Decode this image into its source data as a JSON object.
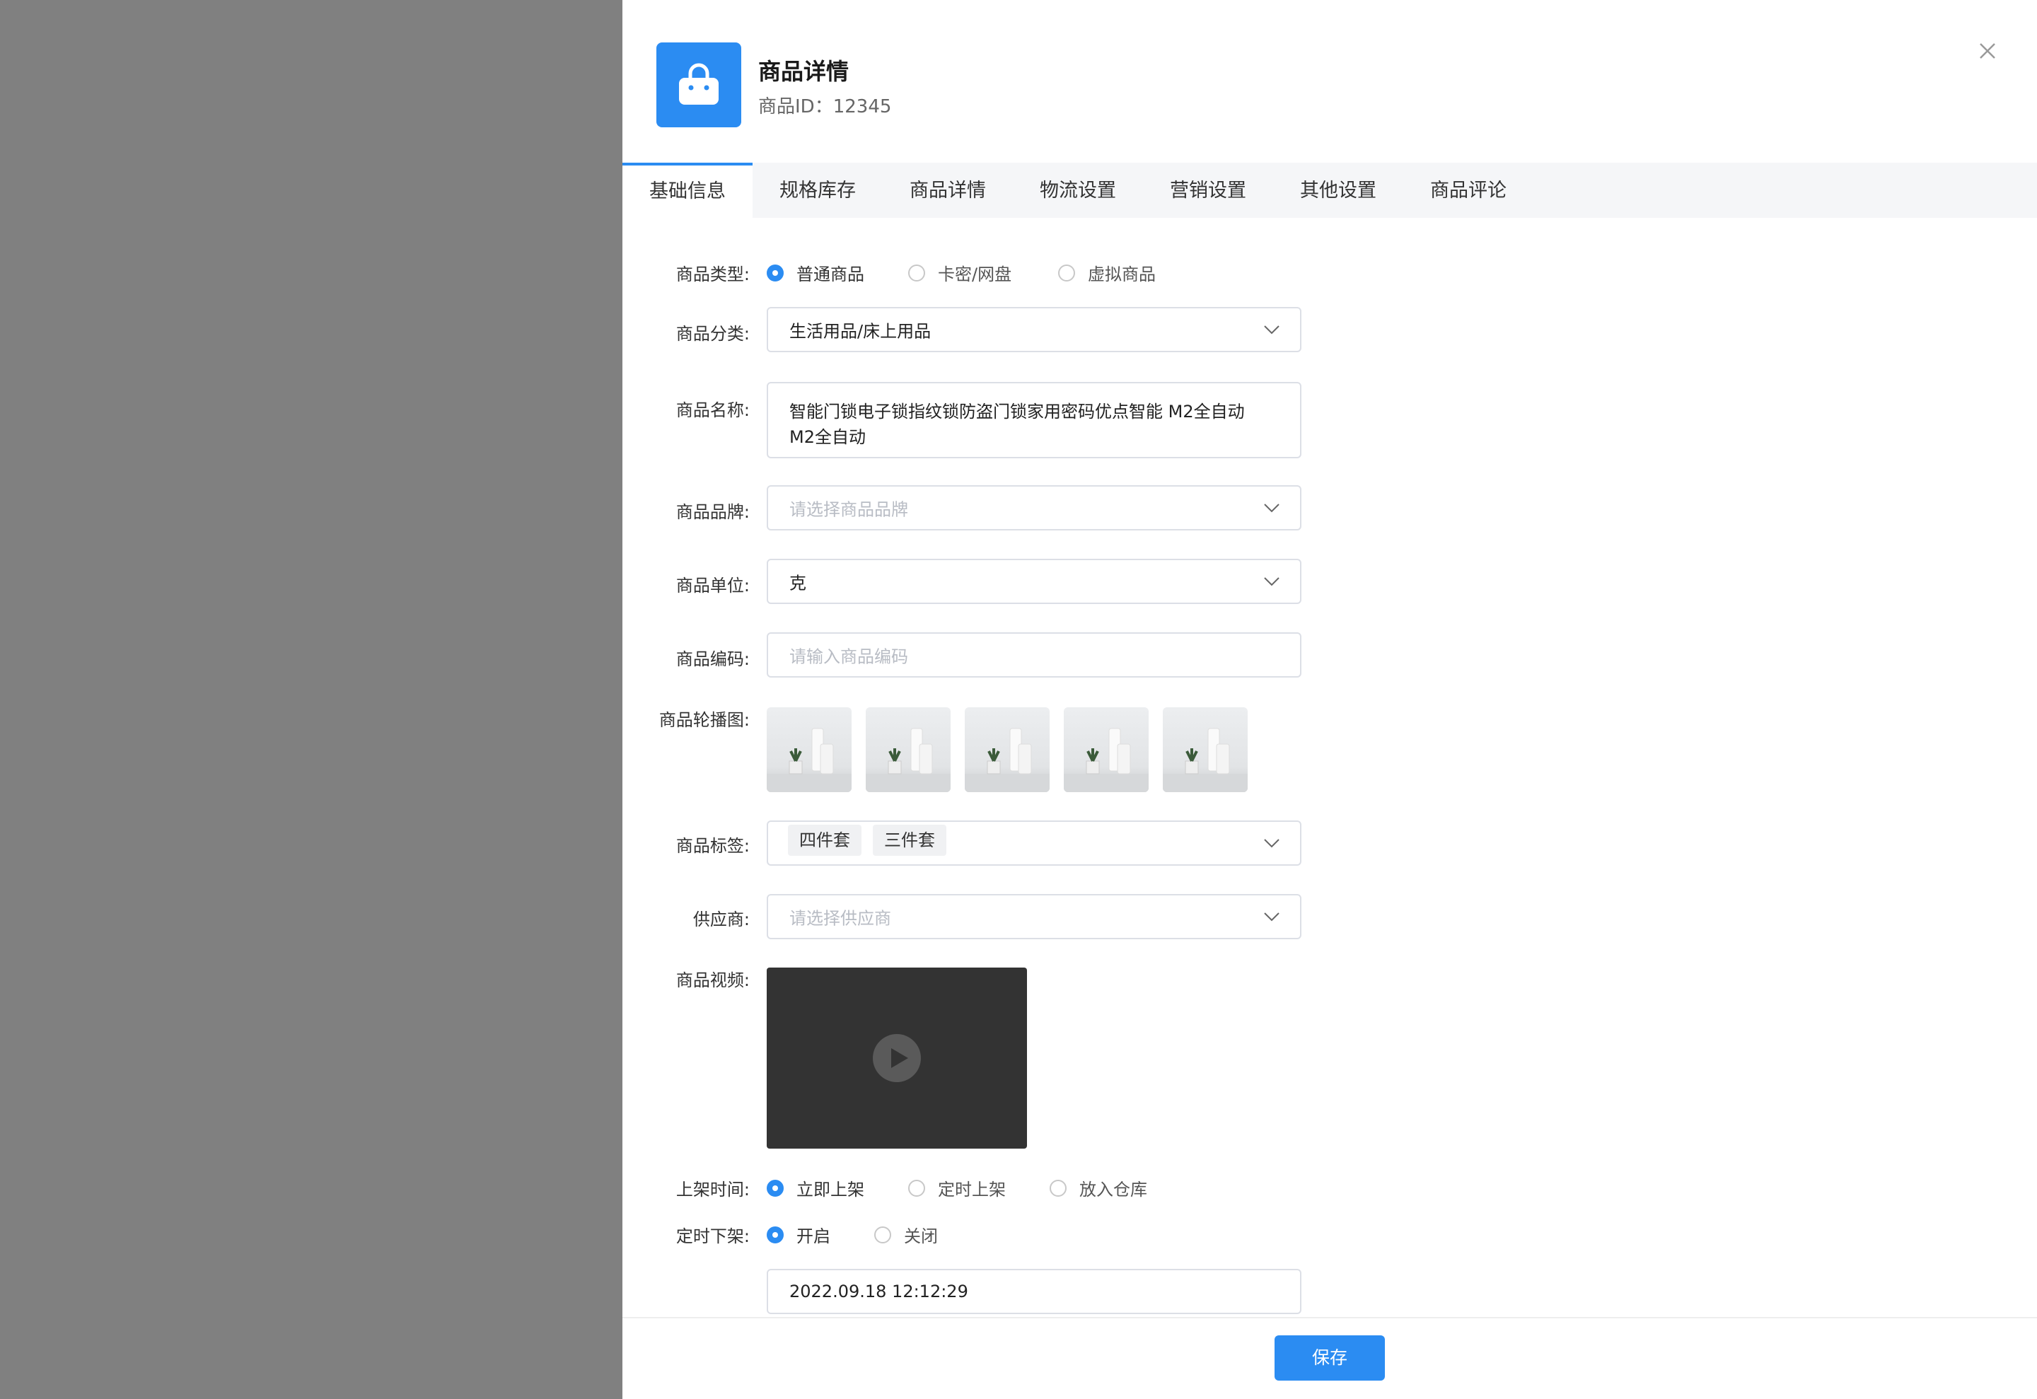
{
  "header": {
    "title": "商品详情",
    "subtitle": "商品ID：12345"
  },
  "tabs": [
    "基础信息",
    "规格库存",
    "商品详情",
    "物流设置",
    "营销设置",
    "其他设置",
    "商品评论"
  ],
  "form": {
    "type": {
      "label": "商品类型:",
      "options": [
        "普通商品",
        "卡密/网盘",
        "虚拟商品"
      ],
      "selected": "普通商品"
    },
    "category": {
      "label": "商品分类:",
      "value": "生活用品/床上用品"
    },
    "name": {
      "label": "商品名称:",
      "value_line1": "智能门锁电子锁指纹锁防盗门锁家用密码优点智能 M2全自动",
      "value_line2": "M2全自动"
    },
    "brand": {
      "label": "商品品牌:",
      "placeholder": "请选择商品品牌"
    },
    "unit": {
      "label": "商品单位:",
      "value": "克"
    },
    "code": {
      "label": "商品编码:",
      "placeholder": "请输入商品编码"
    },
    "carousel": {
      "label": "商品轮播图:",
      "image_count": 5
    },
    "tags": {
      "label": "商品标签:",
      "items": [
        "四件套",
        "三件套"
      ]
    },
    "supplier": {
      "label": "供应商:",
      "placeholder": "请选择供应商"
    },
    "video": {
      "label": "商品视频:"
    },
    "listing_time": {
      "label": "上架时间:",
      "options": [
        "立即上架",
        "定时上架",
        "放入仓库"
      ],
      "selected": "立即上架"
    },
    "timed_delist": {
      "label": "定时下架:",
      "options": [
        "开启",
        "关闭"
      ],
      "selected": "开启"
    },
    "delist_datetime": {
      "value": "2022.09.18 12:12:29"
    }
  },
  "footer": {
    "save_label": "保存"
  },
  "colors": {
    "accent": "#2b8cf2",
    "overlay": "#808080",
    "video_bg": "#333333"
  }
}
